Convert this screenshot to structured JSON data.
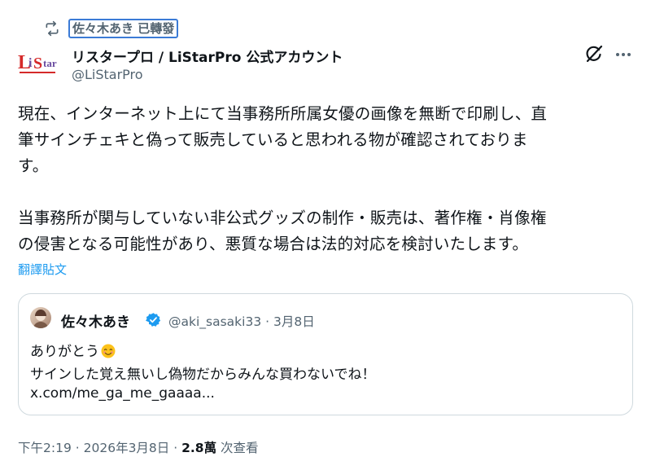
{
  "retweet": {
    "label": "佐々木あき 已轉發",
    "icon": "retweet-icon"
  },
  "author": {
    "name": "リスタープロ / LiStarPro 公式アカウント",
    "handle": "@LiStarPro",
    "avatar_text": "LiStar",
    "brand_colors": {
      "red": "#d52a2a",
      "purple": "#6a4ca0"
    }
  },
  "actions": {
    "grok_icon": "grok-icon",
    "more_icon": "more-icon"
  },
  "tweet": {
    "line1": "現在、インターネット上にて当事務所所属女優の画像を無断で印刷し、直",
    "line2": "筆サインチェキと偽って販売していると思われる物が確認されておりま",
    "line3": "す。",
    "line4": "当事務所が関与していない非公式グッズの制作・販売は、著作権・肖像権",
    "line5": "の侵害となる可能性があり、悪質な場合は法的対応を検討いたします。",
    "translate": "翻譯貼文"
  },
  "quote": {
    "name": "佐々木あき",
    "handle": "@aki_sasaki33",
    "separator": "·",
    "date": "3月8日",
    "line1": "ありがとう",
    "line2": "サインした覚え無いし偽物だからみんな買わないでね！",
    "line3": "x.com/me_ga_me_gaaaa...",
    "verified_color": "#1d9bf0"
  },
  "footer": {
    "time": "下午2:19",
    "separator": "·",
    "date": "2026年3月8日",
    "views_count": "2.8萬",
    "views_label": "次查看"
  }
}
